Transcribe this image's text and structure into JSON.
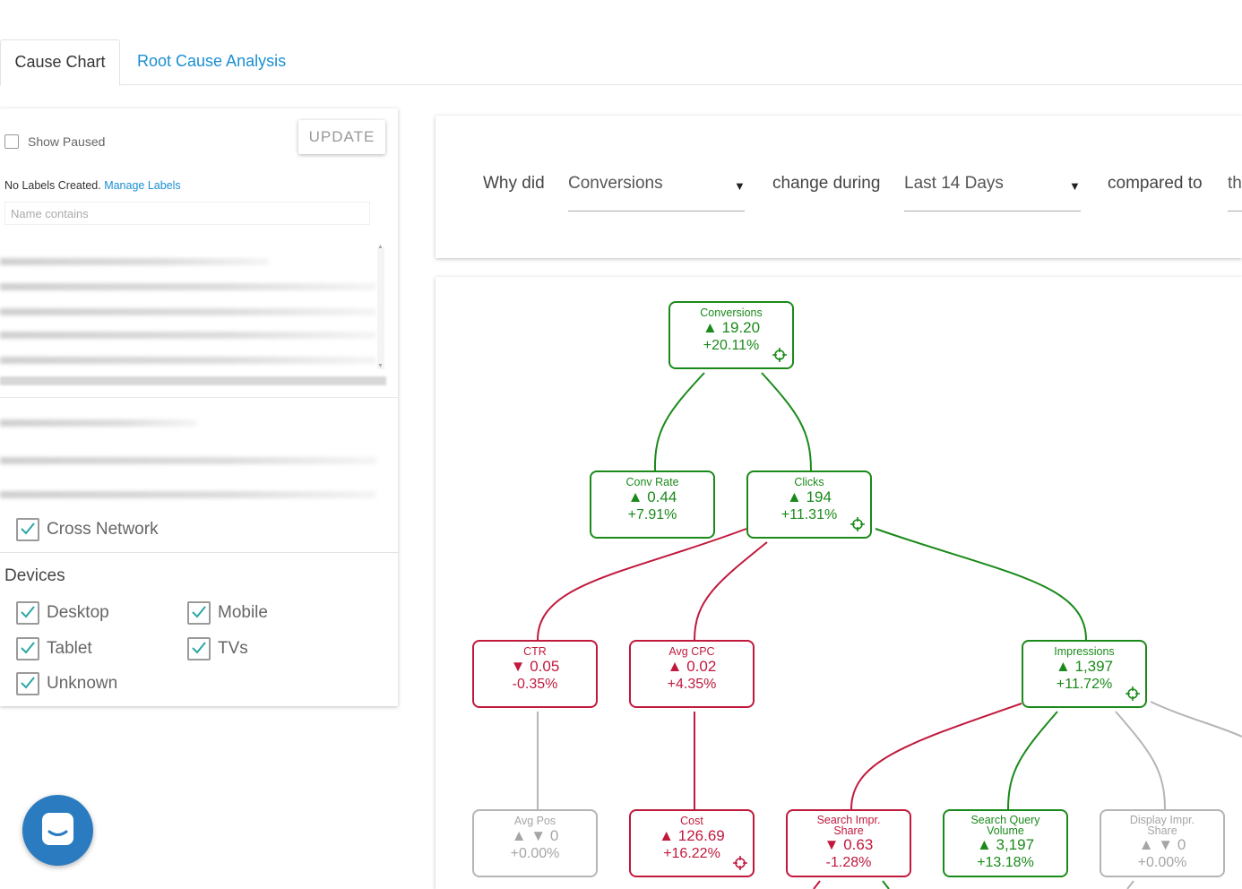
{
  "tabs": [
    {
      "label": "Cause Chart"
    },
    {
      "label": "Root Cause Analysis"
    }
  ],
  "sidebar": {
    "show_paused": "Show Paused",
    "update": "UPDATE",
    "labels_text": "No Labels Created.",
    "manage_labels": "Manage Labels",
    "name_placeholder": "Name contains",
    "cross_network": "Cross Network",
    "devices_title": "Devices",
    "devices": [
      "Desktop",
      "Mobile",
      "Tablet",
      "TVs",
      "Unknown"
    ]
  },
  "query": {
    "why_did": "Why did",
    "metric": "Conversions",
    "change_during": "change during",
    "period": "Last 14 Days",
    "compared_to": "compared to",
    "trailing": "th"
  },
  "tree": {
    "conversions": {
      "title": "Conversions",
      "value": "▲ 19.20",
      "pct": "+20.11%"
    },
    "conv_rate": {
      "title": "Conv Rate",
      "value": "▲ 0.44",
      "pct": "+7.91%"
    },
    "clicks": {
      "title": "Clicks",
      "value": "▲ 194",
      "pct": "+11.31%"
    },
    "ctr": {
      "title": "CTR",
      "value": "▼ 0.05",
      "pct": "-0.35%"
    },
    "avg_cpc": {
      "title": "Avg CPC",
      "value": "▲ 0.02",
      "pct": "+4.35%"
    },
    "impressions": {
      "title": "Impressions",
      "value": "▲ 1,397",
      "pct": "+11.72%"
    },
    "avg_pos": {
      "title": "Avg Pos",
      "value": "▲ ▼ 0",
      "pct": "+0.00%"
    },
    "cost": {
      "title": "Cost",
      "value": "▲ 126.69",
      "pct": "+16.22%"
    },
    "search_impr_share": {
      "title_1": "Search Impr.",
      "title_2": "Share",
      "value": "▼ 0.63",
      "pct": "-1.28%"
    },
    "search_query_volume": {
      "title_1": "Search Query",
      "title_2": "Volume",
      "value": "▲ 3,197",
      "pct": "+13.18%"
    },
    "display_impr_share": {
      "title_1": "Display Impr.",
      "title_2": "Share",
      "value": "▲ ▼ 0",
      "pct": "+0.00%"
    }
  },
  "colors": {
    "accent": "#1a8fd0",
    "positive": "#1a8a1a",
    "negative": "#c0193c",
    "neutral": "#b5b5b5",
    "chat": "#2a7bc0"
  },
  "icons": [
    "crosshair-icon",
    "checkmark-icon",
    "dropdown-arrow-icon",
    "chat-icon"
  ]
}
